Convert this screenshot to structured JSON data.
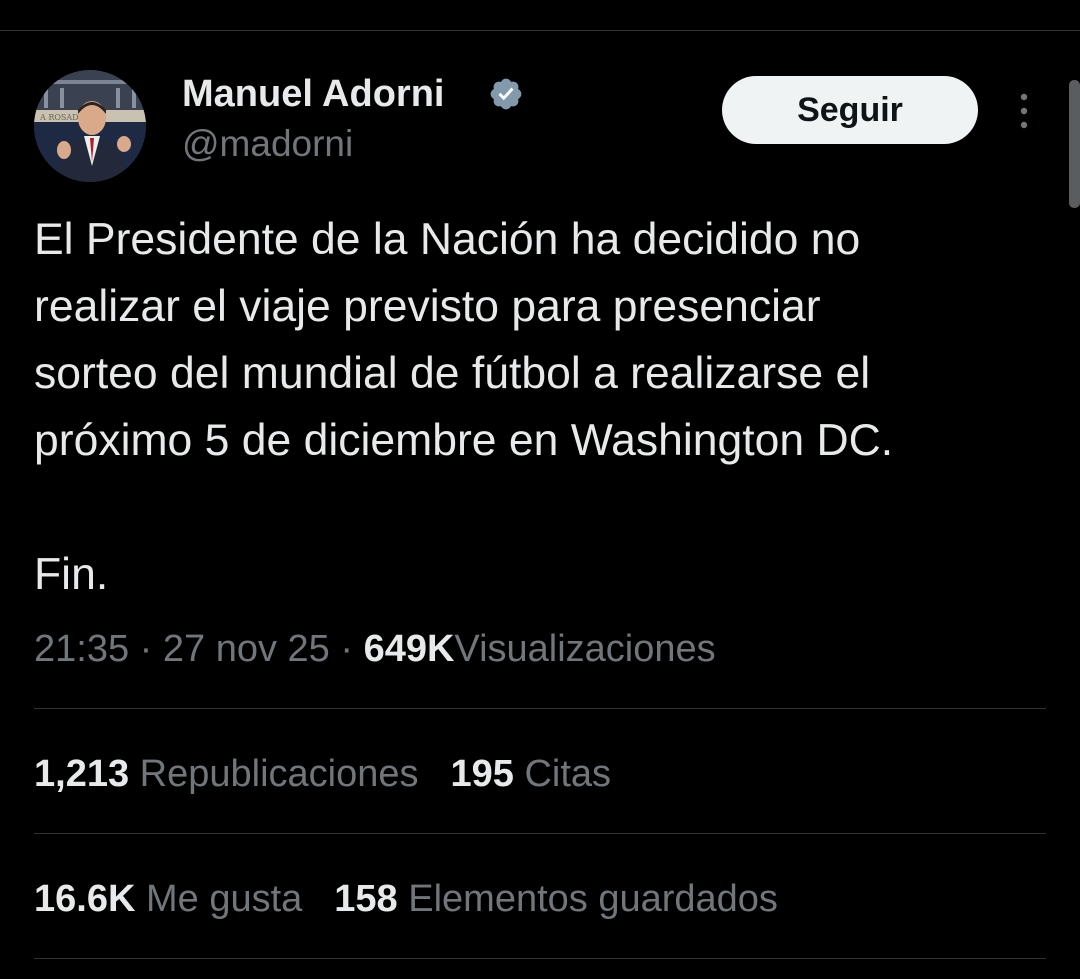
{
  "author": {
    "name": "Manuel Adorni",
    "handle": "@madorni",
    "verified_color": "#829aab",
    "avatar_sign_text": "A ROSADA"
  },
  "follow_button": {
    "label": "Seguir"
  },
  "more_menu": {
    "icon": "more-vertical-icon"
  },
  "tweet": {
    "text": "El Presidente de la Nación ha decidido no\nrealizar el viaje previsto para presenciar\nsorteo del mundial de fútbol a realizarse el\npróximo 5 de diciembre en Washington DC.\n\nFin."
  },
  "meta": {
    "time": "21:35",
    "separator": "·",
    "date": "27 nov 25",
    "views_count": "649K",
    "views_label": "Visualizaciones"
  },
  "stats": {
    "reposts_count": "1,213",
    "reposts_label": "Republicaciones",
    "quotes_count": "195",
    "quotes_label": "Citas",
    "likes_count": "16.6K",
    "likes_label": "Me gusta",
    "bookmarks_count": "158",
    "bookmarks_label": "Elementos guardados"
  },
  "colors": {
    "background": "#000000",
    "primary_text": "#e7e9ea",
    "secondary_text": "#71767b",
    "divider": "#2f3336",
    "button_bg": "#eff3f4"
  }
}
